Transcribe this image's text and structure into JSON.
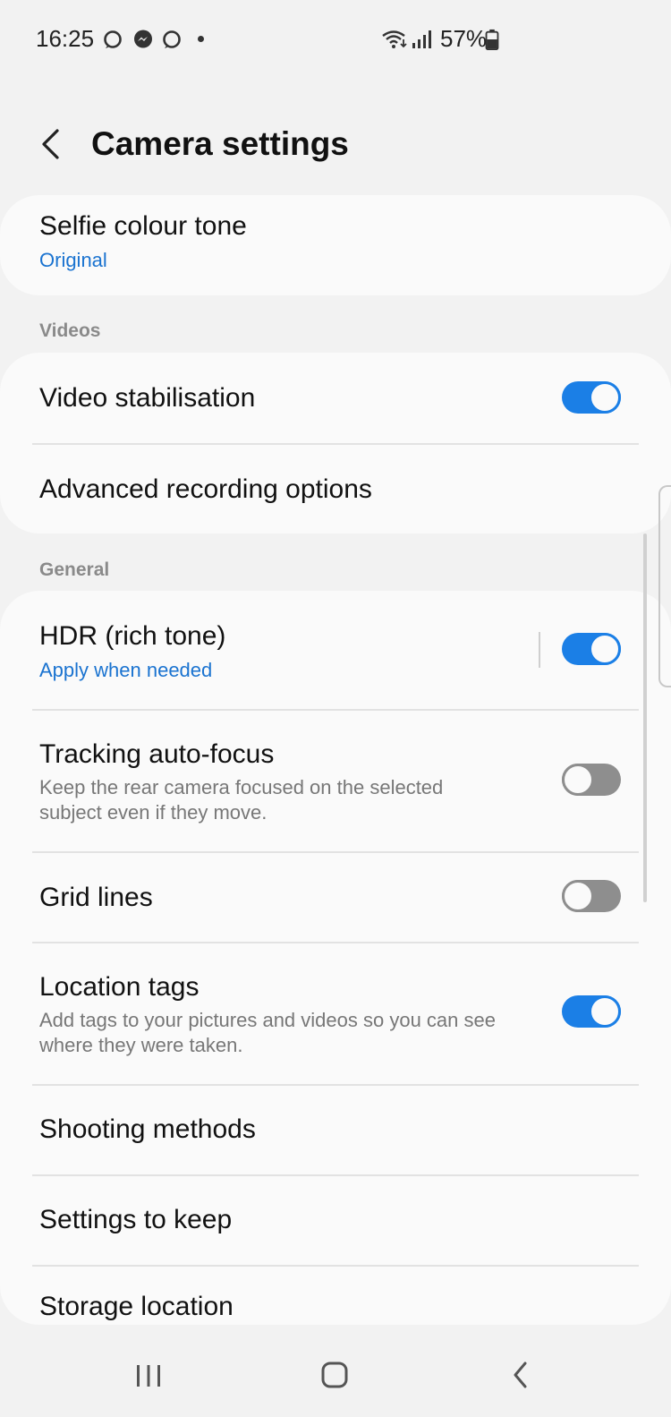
{
  "status_bar": {
    "time": "16:25",
    "battery_percent": "57%",
    "icons": [
      "ring-notification-icon",
      "messenger-icon",
      "ring-notification-icon",
      "dot-icon",
      "wifi-icon",
      "signal-icon",
      "battery-icon"
    ]
  },
  "header": {
    "title": "Camera settings",
    "back_icon": "back-arrow-icon"
  },
  "selfie_card": {
    "title": "Selfie colour tone",
    "value": "Original"
  },
  "videos_section": {
    "label": "Videos",
    "items": [
      {
        "title": "Video stabilisation",
        "toggle": true
      },
      {
        "title": "Advanced recording options"
      }
    ]
  },
  "general_section": {
    "label": "General",
    "hdr": {
      "title": "HDR (rich tone)",
      "value": "Apply when needed",
      "toggle": true
    },
    "tracking": {
      "title": "Tracking auto-focus",
      "description": "Keep the rear camera focused on the selected subject even if they move.",
      "toggle": false
    },
    "grid": {
      "title": "Grid lines",
      "toggle": false
    },
    "location": {
      "title": "Location tags",
      "description": "Add tags to your pictures and videos so you can see where they were taken.",
      "toggle": true
    },
    "shooting_methods": {
      "title": "Shooting methods"
    },
    "settings_to_keep": {
      "title": "Settings to keep"
    },
    "storage_location": {
      "title": "Storage location"
    }
  },
  "colors": {
    "accent": "#1b7fe6",
    "link_blue": "#1a73d0",
    "background": "#f2f2f2",
    "card": "#fafafa",
    "switch_off": "#8e8e8e"
  },
  "nav_bar": {
    "icons": [
      "recent-apps-icon",
      "home-icon",
      "back-icon"
    ]
  }
}
